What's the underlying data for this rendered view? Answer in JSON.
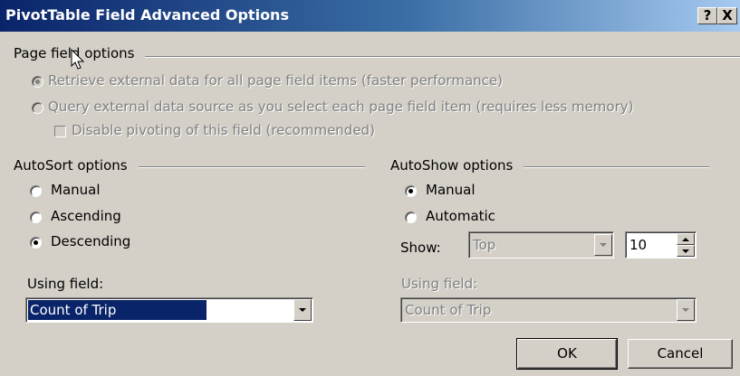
{
  "window": {
    "title": "PivotTable Field Advanced Options",
    "help_button": "?",
    "close_button": "X"
  },
  "page_field_options": {
    "label": "Page field options",
    "radio_retrieve": {
      "label": "Retrieve external data for all page field items (faster performance)",
      "selected": true,
      "enabled": false
    },
    "radio_query": {
      "label": "Query external data source as you select each page field item (requires less memory)",
      "selected": false,
      "enabled": false
    },
    "checkbox_disable_pivoting": {
      "label": "Disable pivoting of this field (recommended)",
      "checked": false,
      "enabled": false
    }
  },
  "autosort": {
    "label": "AutoSort options",
    "radios": [
      {
        "label": "Manual",
        "selected": false
      },
      {
        "label": "Ascending",
        "selected": false
      },
      {
        "label": "Descending",
        "selected": true
      }
    ],
    "using_field_label": "Using field:",
    "using_field_value": "Count of Trip"
  },
  "autoshow": {
    "label": "AutoShow options",
    "radios": [
      {
        "label": "Manual",
        "selected": true
      },
      {
        "label": "Automatic",
        "selected": false
      }
    ],
    "show_label": "Show:",
    "show_value": "Top",
    "count_value": "10",
    "using_field_label": "Using field:",
    "using_field_value": "Count of Trip"
  },
  "buttons": {
    "ok": "OK",
    "cancel": "Cancel"
  }
}
